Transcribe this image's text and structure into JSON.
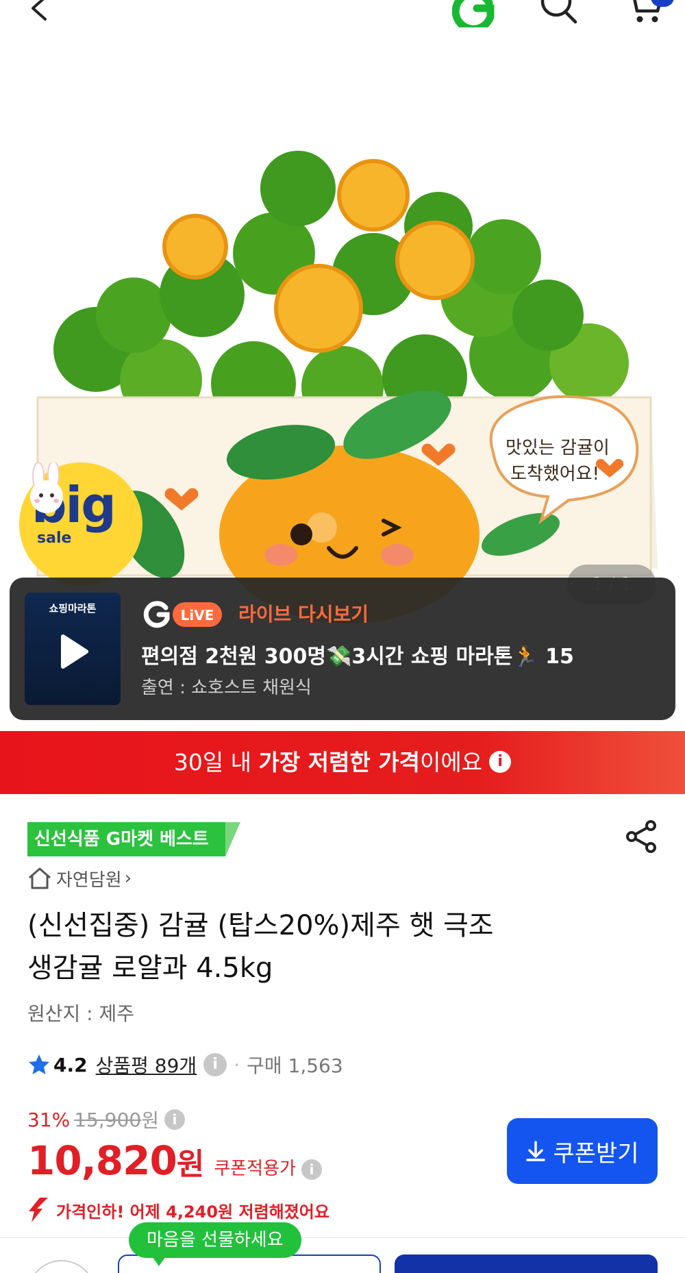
{
  "header": {
    "back_icon": "chevron-left-icon",
    "logo_icon": "gmarket-g-logo",
    "search_icon": "search-icon",
    "cart_icon": "cart-icon"
  },
  "hero": {
    "page_indicator": "1 / 1",
    "badge_big": "big",
    "badge_sale": "sale",
    "box_text_line1": "맛있는 감귤이",
    "box_text_line2": "도착했어요!"
  },
  "live": {
    "thumb_title": "쇼핑마라톤",
    "badge": "LiVE",
    "label": "라이브 다시보기",
    "title": "편의점 2천원 300명💸3시간 쇼핑 마라톤🏃 15",
    "host": "출연 : 쇼호스트 채원식"
  },
  "banner": {
    "prefix": "30일 내 ",
    "highlight": "가장 저렴한 가격",
    "suffix": "이에요",
    "info": "i"
  },
  "product": {
    "best_badge": "신선식품 G마켓 베스트",
    "store_name": "자연담원",
    "store_chevron": "›",
    "title_line1": "(신선집중) 감귤 (탑스20%)제주 햇 극조",
    "title_line2": "생감귤 로얄과 4.5kg",
    "origin": "원산지 : 제주",
    "rating": "4.2",
    "review_label": "상품평 89개",
    "dot": "·",
    "purchase": "구매 1,563",
    "info": "i"
  },
  "price": {
    "discount": "31%",
    "original": "15,900",
    "original_unit": "원",
    "final": "10,820",
    "final_unit": "원",
    "coupon_label": "쿠폰적용가",
    "coupon_button": "쿠폰받기",
    "drop_text": "가격인하! 어제 4,240원 저렴해졌어요"
  },
  "bottom": {
    "gift_bubble": "마음을 선물하세요"
  },
  "colors": {
    "accent_red": "#e11f26",
    "brand_blue": "#1455f0",
    "fresh_green": "#2bc23e"
  }
}
